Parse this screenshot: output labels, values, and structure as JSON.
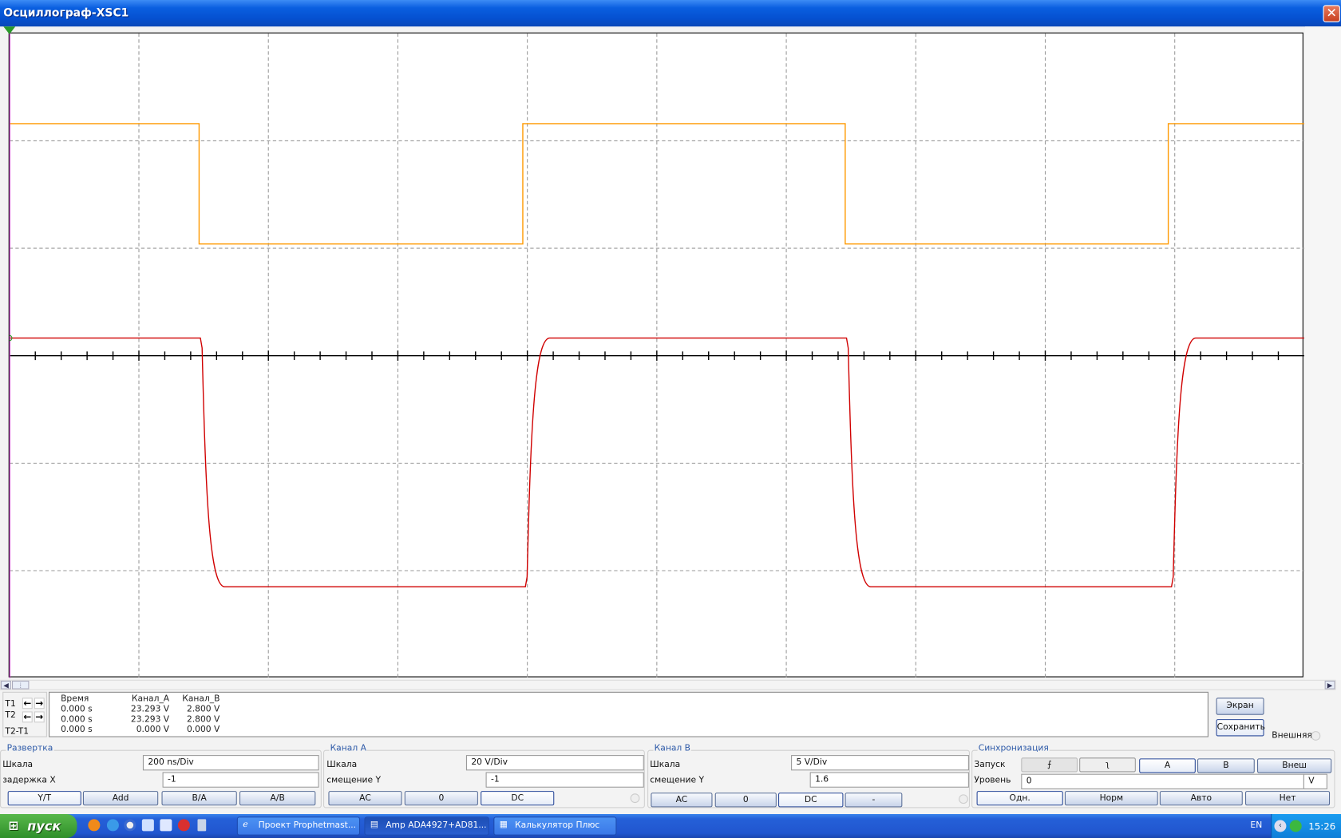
{
  "window": {
    "title": "Осциллограф-XSC1",
    "close_icon": "close-icon"
  },
  "colors": {
    "channel_a": "#d00000",
    "channel_b": "#ff9900",
    "cursor": "#cc33cc",
    "grid": "#999999"
  },
  "readout": {
    "headers": [
      "Время",
      "Канал_A",
      "Канал_B"
    ],
    "rows": [
      {
        "label": "T1",
        "time": "0.000 s",
        "a": "23.293 V",
        "b": "2.800 V"
      },
      {
        "label": "T2",
        "time": "0.000 s",
        "a": "23.293 V",
        "b": "2.800 V"
      },
      {
        "label": "T2-T1",
        "time": "0.000 s",
        "a": "0.000 V",
        "b": "0.000 V"
      }
    ]
  },
  "side_buttons": {
    "screen": "Экран",
    "save": "Сохранить",
    "external": "Внешняя"
  },
  "timebase": {
    "title": "Развертка",
    "scale_label": "Шкала",
    "scale": "200 ns/Div",
    "delay_label": "задержка X",
    "delay": "-1",
    "modes": [
      "Y/T",
      "Add",
      "B/A",
      "A/B"
    ],
    "active_mode": "Y/T"
  },
  "channel_a": {
    "title": "Канал А",
    "scale_label": "Шкала",
    "scale": "20  V/Div",
    "offset_label": "смещение Y",
    "offset": "-1",
    "coupling": [
      "AC",
      "0",
      "DC"
    ],
    "active": "DC"
  },
  "channel_b": {
    "title": "Канал B",
    "scale_label": "Шкала",
    "scale": "5  V/Div",
    "offset_label": "смещение Y",
    "offset": "1.6",
    "coupling": [
      "AC",
      "0",
      "DC",
      "-"
    ],
    "active": "DC"
  },
  "trigger": {
    "title": "Синхронизация",
    "start_label": "Запуск",
    "edges": [
      "rising-edge-icon",
      "falling-edge-icon"
    ],
    "edge_glyphs": [
      "⨍",
      "ʅ"
    ],
    "sources": [
      "A",
      "B",
      "Внеш"
    ],
    "active_source": "A",
    "level_label": "Уровень",
    "level": "0",
    "level_unit": "V",
    "modes": [
      "Одн.",
      "Норм",
      "Авто",
      "Нет"
    ],
    "active_mode": "Одн."
  },
  "taskbar": {
    "start": "пуск",
    "tasks": [
      "Проект Prophetmast...",
      "Amp ADA4927+AD81...",
      "Калькулятор Плюс"
    ],
    "active_task": 1,
    "lang": "EN",
    "clock": "15:26"
  },
  "chart_data": {
    "type": "line",
    "x_unit": "ns",
    "xlim": [
      0,
      2000
    ],
    "x_divisions": 10,
    "y_divisions": 6,
    "grid": true,
    "series": [
      {
        "channel": "A",
        "color": "#d00000",
        "volts_per_div": 20,
        "offset_div": -1,
        "high": 23.293,
        "low": -23.0,
        "edges_ns": [
          295,
          797,
          1293,
          1795
        ],
        "start": "high"
      },
      {
        "channel": "B",
        "color": "#ff9900",
        "volts_per_div": 5,
        "offset_div": 1.6,
        "high": 2.8,
        "low": -2.8,
        "edges_ns": [
          293,
          793,
          1291,
          1790
        ],
        "start": "high"
      }
    ]
  }
}
